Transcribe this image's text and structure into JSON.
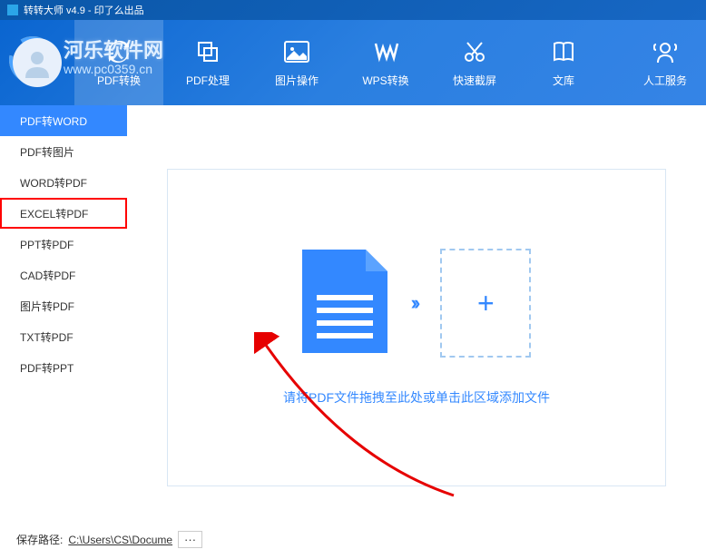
{
  "titlebar": {
    "title": "转转大师 v4.9 - 印了么出品"
  },
  "watermark": {
    "text": "河乐软件网",
    "sub": "www.pc0359.cn"
  },
  "nav": {
    "items": [
      {
        "label": "PDF转换",
        "icon": "refresh"
      },
      {
        "label": "PDF处理",
        "icon": "copy"
      },
      {
        "label": "图片操作",
        "icon": "image"
      },
      {
        "label": "WPS转换",
        "icon": "wps"
      },
      {
        "label": "快速截屏",
        "icon": "scissors"
      },
      {
        "label": "文库",
        "icon": "book"
      },
      {
        "label": "人工服务",
        "icon": "support"
      }
    ]
  },
  "sidebar": {
    "items": [
      "PDF转WORD",
      "PDF转图片",
      "WORD转PDF",
      "EXCEL转PDF",
      "PPT转PDF",
      "CAD转PDF",
      "图片转PDF",
      "TXT转PDF",
      "PDF转PPT"
    ],
    "active_index": 0,
    "highlighted_index": 3
  },
  "dropzone": {
    "hint": "请将PDF文件拖拽至此处或单击此区域添加文件"
  },
  "footer": {
    "label": "保存路径:",
    "path": "C:\\Users\\CS\\Docume",
    "browse": "···"
  }
}
